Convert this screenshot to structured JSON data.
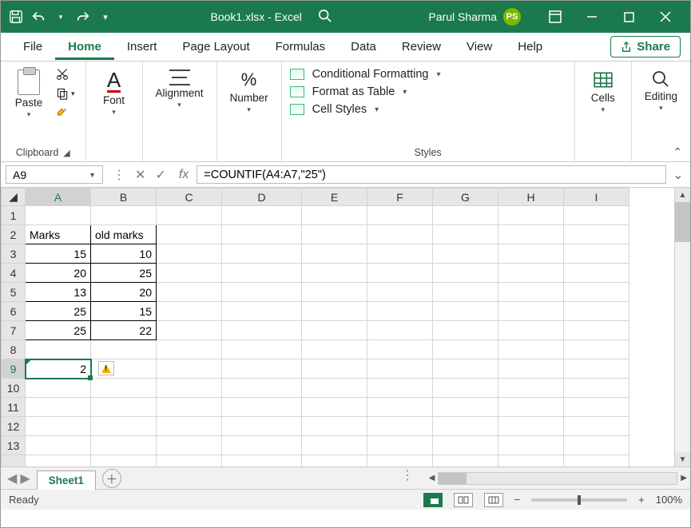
{
  "titlebar": {
    "doc_title": "Book1.xlsx - Excel",
    "user_name": "Parul Sharma",
    "user_initials": "PS"
  },
  "menu": {
    "file": "File",
    "home": "Home",
    "insert": "Insert",
    "page_layout": "Page Layout",
    "formulas": "Formulas",
    "data": "Data",
    "review": "Review",
    "view": "View",
    "help": "Help",
    "share": "Share"
  },
  "ribbon": {
    "clipboard": {
      "paste": "Paste",
      "label": "Clipboard"
    },
    "font": {
      "btn": "Font"
    },
    "alignment": {
      "btn": "Alignment"
    },
    "number": {
      "btn": "Number"
    },
    "styles": {
      "cond": "Conditional Formatting",
      "table": "Format as Table",
      "cellstyles": "Cell Styles",
      "label": "Styles"
    },
    "cells": {
      "btn": "Cells"
    },
    "editing": {
      "btn": "Editing"
    }
  },
  "formula_bar": {
    "name_box": "A9",
    "formula": "=COUNTIF(A4:A7,\"25\")"
  },
  "columns": [
    "A",
    "B",
    "C",
    "D",
    "E",
    "F",
    "G",
    "H",
    "I"
  ],
  "rows": [
    "1",
    "2",
    "3",
    "4",
    "5",
    "6",
    "7",
    "8",
    "9",
    "10",
    "11",
    "12",
    "13"
  ],
  "sheet_data": {
    "A2": "Marks",
    "B2": "old marks",
    "A3": "15",
    "B3": "10",
    "A4": "20",
    "B4": "25",
    "A5": "13",
    "B5": "20",
    "A6": "25",
    "B6": "15",
    "A7": "25",
    "B7": "22",
    "A9": "2"
  },
  "sheet_tab": "Sheet1",
  "status": {
    "ready": "Ready",
    "zoom": "100%"
  }
}
